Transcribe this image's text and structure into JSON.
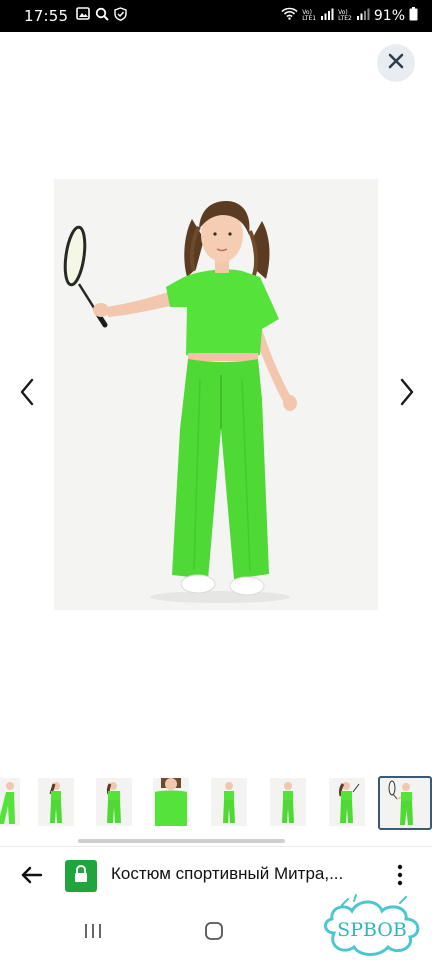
{
  "status_bar": {
    "time": "17:55",
    "sim1_top": "Vo)",
    "sim1_bottom": "LTE1",
    "sim2_top": "Vo)",
    "sim2_bottom": "LTE2",
    "battery": "91%",
    "icons": [
      "gallery-icon",
      "search-icon",
      "shield-icon",
      "wifi-icon",
      "signal-icon",
      "battery-icon"
    ]
  },
  "viewer": {
    "close_icon": "close-icon",
    "prev_icon": "chevron-left-icon",
    "next_icon": "chevron-right-icon",
    "thumbnail_count": 8,
    "selected_thumbnail": 8,
    "colors": {
      "outfit_green": "#55e23a",
      "selected_border": "#3a5a73"
    }
  },
  "browser_bar": {
    "title": "Костюм спортивный Митра,...",
    "secure_color": "#1fa53b",
    "icons": [
      "back-arrow-icon",
      "lock-icon",
      "more-vertical-icon"
    ]
  },
  "system_nav": {
    "icons": [
      "recents-icon",
      "home-icon"
    ]
  },
  "watermark": {
    "text": "SPBOB"
  }
}
